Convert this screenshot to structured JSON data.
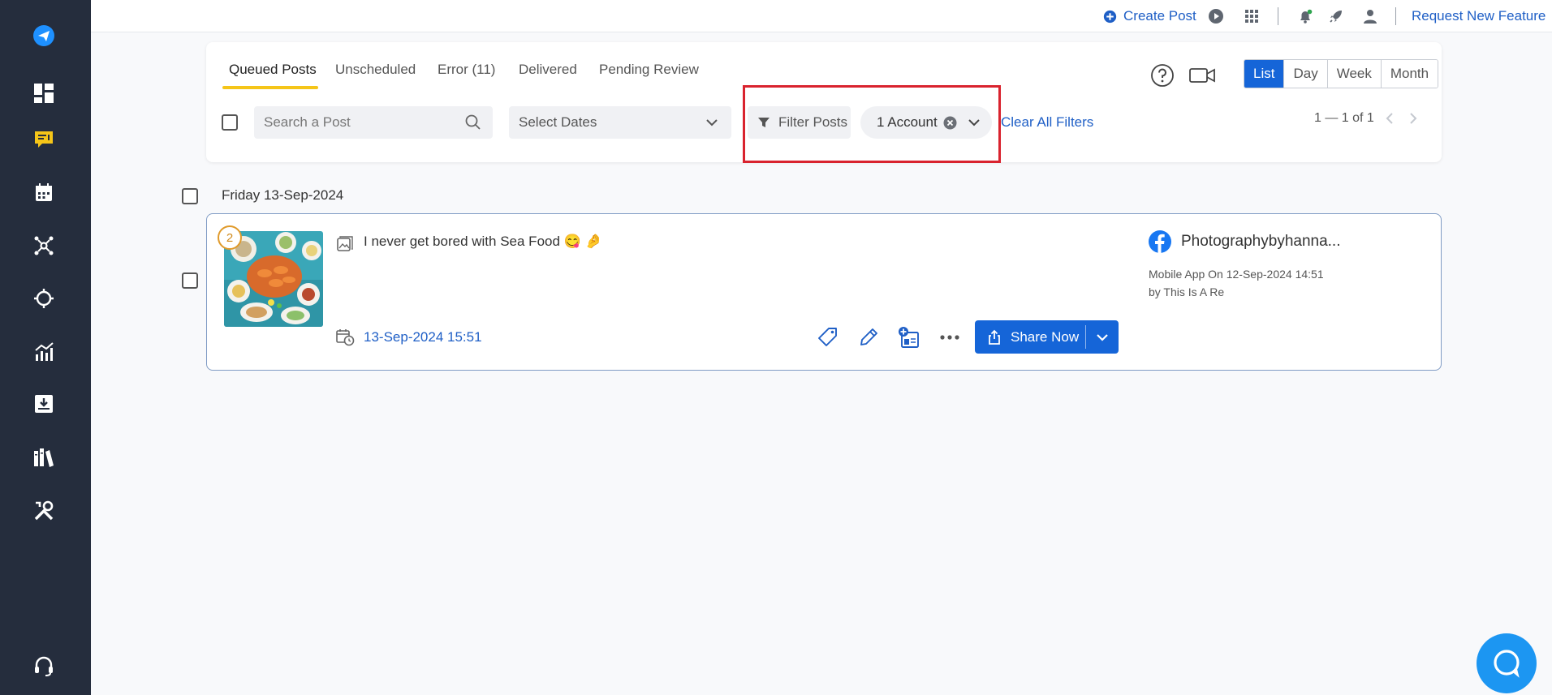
{
  "topbar": {
    "create_post": "Create Post",
    "request_feature": "Request New Feature"
  },
  "tabs": [
    {
      "label": "Queued Posts",
      "active": true
    },
    {
      "label": "Unscheduled"
    },
    {
      "label": "Error (11)"
    },
    {
      "label": "Delivered"
    },
    {
      "label": "Pending Review"
    }
  ],
  "filters": {
    "search_placeholder": "Search a Post",
    "dates_label": "Select Dates",
    "filter_label": "Filter Posts",
    "account_chip": "1 Account",
    "clear_all": "Clear All Filters"
  },
  "views": [
    "List",
    "Day",
    "Week",
    "Month"
  ],
  "active_view": "List",
  "pager": "1 — 1 of 1",
  "group": {
    "title": "Friday 13-Sep-2024"
  },
  "post": {
    "badge": "2",
    "text": "I never get bored with Sea Food 😋 🤌",
    "scheduled": "13-Sep-2024 15:51",
    "share_label": "Share Now",
    "account_name": "Photographybyhanna...",
    "meta_line1": "Mobile App On 12-Sep-2024 14:51",
    "meta_line2": "by This Is A Re"
  },
  "colors": {
    "sidebar": "#252d3d",
    "accent": "#1565d8",
    "link": "#1f5fc6",
    "tab_underline": "#f5c518",
    "highlight": "#d9232e"
  }
}
